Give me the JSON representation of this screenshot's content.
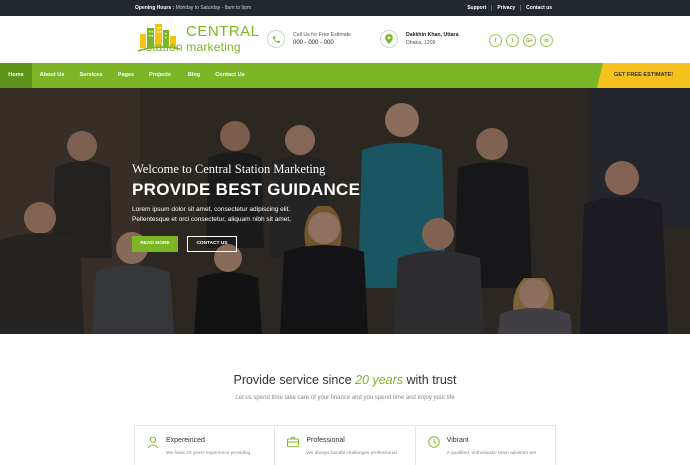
{
  "topbar": {
    "hours_label": "Opening Hours :",
    "hours_value": "Monday to Saturday - 8am to 9pm",
    "links": [
      "Support",
      "Privacy",
      "Contact us"
    ]
  },
  "logo": {
    "line1": "CENTRAL",
    "line2": "station marketing"
  },
  "header": {
    "phone": {
      "label": "Call Us for Free Estimate",
      "value": "000 - 000 - 000",
      "icon": "phone-icon"
    },
    "address": {
      "line1": "Dakkhin Khan, Uttara",
      "line2": "Dhaka, 1209",
      "icon": "map-pin-icon"
    },
    "social": [
      "f",
      "t",
      "G+",
      "in"
    ]
  },
  "nav": {
    "items": [
      "Home",
      "About Us",
      "Services",
      "Pages",
      "Projects",
      "Blog",
      "Contact Us"
    ],
    "active": "Home",
    "cta": "GET FREE ESTIMATE!"
  },
  "hero": {
    "welcome": "Welcome to Central Station Marketing",
    "headline": "PROVIDE BEST GUIDANCE",
    "body_line1": "Lorem ipsum dolor sit amet, consectetur adipiscing elit.",
    "body_line2": "Pellentesque et orci consectetur, aliquam nibh sit amet,",
    "primary_button": "READ MORE",
    "secondary_button": "CONTACT US"
  },
  "section": {
    "title_pre": "Provide service since ",
    "title_em": "20 years",
    "title_post": " with trust",
    "subtitle": "Let us spend time take care of your finance and you spend time and enjoy your life",
    "cards": [
      {
        "title": "Expereinced",
        "desc": "We have 20 years experience providing",
        "icon": "user-icon"
      },
      {
        "title": "Professional",
        "desc": "We always handle challenges professional",
        "icon": "briefcase-icon"
      },
      {
        "title": "Vibrant",
        "desc": "A qualified, enthusiastic team advisors are",
        "icon": "clock-icon"
      }
    ]
  },
  "colors": {
    "accent": "#7cb526",
    "accent_dark": "#5e9419",
    "cta": "#f7c11d",
    "topbar": "#23272e"
  }
}
